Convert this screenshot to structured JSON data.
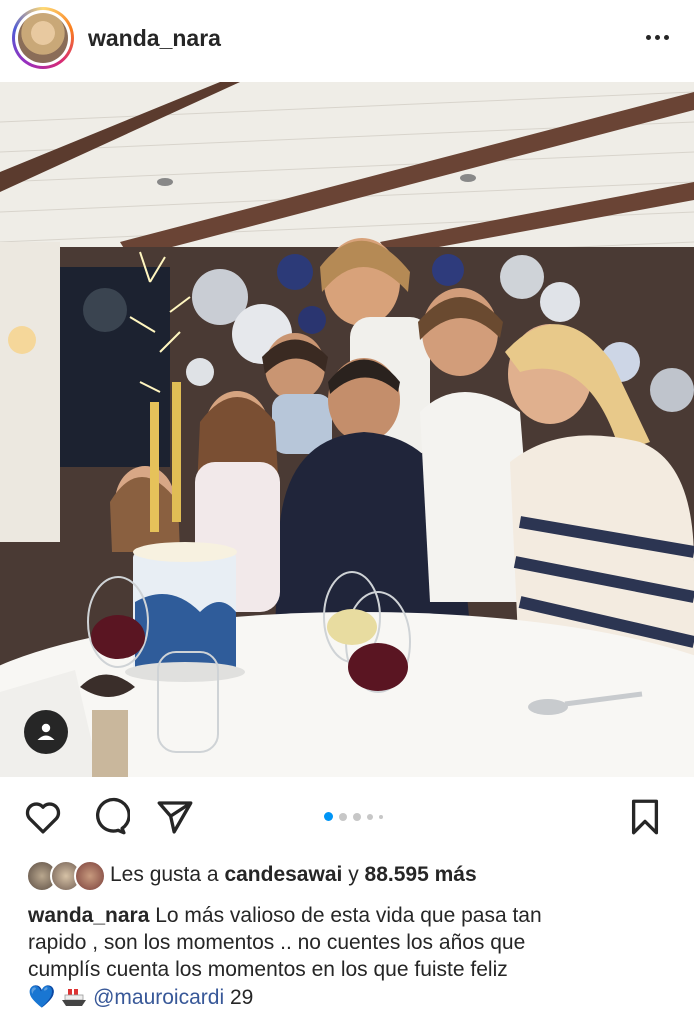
{
  "header": {
    "username": "wanda_nara",
    "more_icon": "more-horizontal-icon"
  },
  "post": {
    "image_icon": "user-tag-icon",
    "carousel": {
      "count": 5,
      "active_index": 0
    }
  },
  "actions": {
    "like_icon": "heart-icon",
    "comment_icon": "comment-icon",
    "share_icon": "send-icon",
    "save_icon": "bookmark-icon"
  },
  "likes": {
    "prefix": "Les gusta a",
    "user": "candesawai",
    "conj": "y",
    "count": "88.595 más"
  },
  "caption": {
    "username": "wanda_nara",
    "line1": "Lo más valioso de esta vida que pasa tan",
    "line2": "rapido , son los momentos .. no cuentes los años que",
    "line3": "cumplís cuenta los momentos en los que fuiste feliz",
    "heart": "💙",
    "mention": "@mauroicardi",
    "number": "29"
  },
  "colors": {
    "text": "#262626",
    "mention": "#385898",
    "carousel_active": "#0095f6",
    "carousel_inactive": "#c7c7c7"
  }
}
